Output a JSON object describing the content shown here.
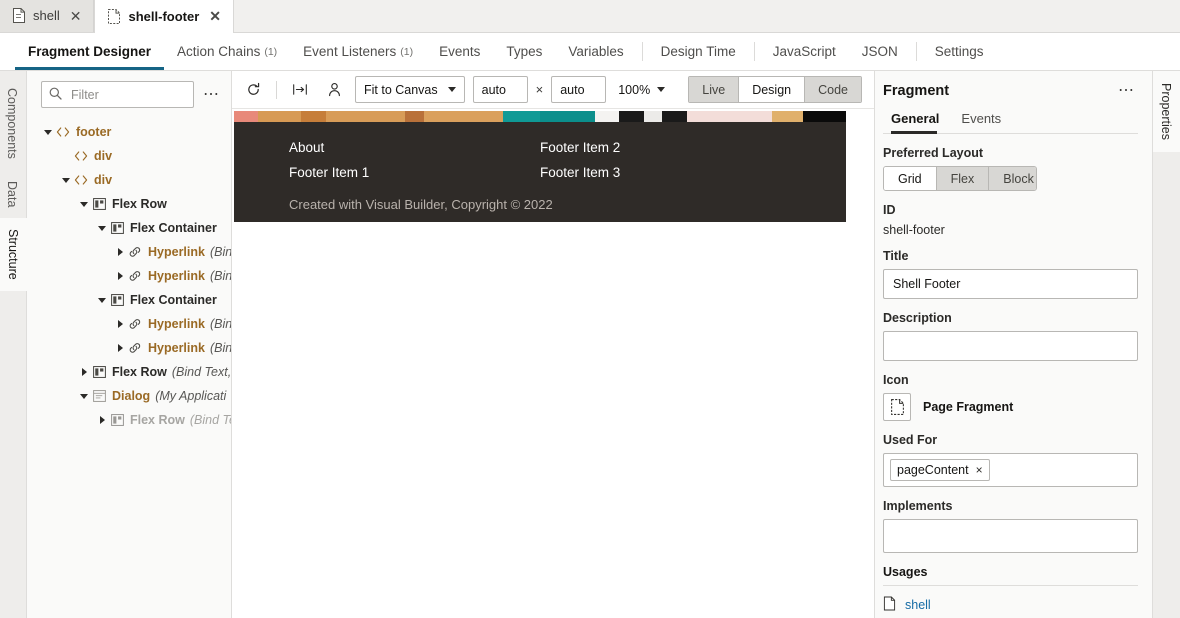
{
  "window_tabs": [
    {
      "label": "shell",
      "icon": "page-icon",
      "active": false
    },
    {
      "label": "shell-footer",
      "icon": "fragment-icon",
      "active": true
    }
  ],
  "nav_tabs": [
    {
      "label": "Fragment Designer",
      "count": "",
      "active": true,
      "sep_after": false
    },
    {
      "label": "Action Chains",
      "count": "(1)",
      "active": false,
      "sep_after": false
    },
    {
      "label": "Event Listeners",
      "count": "(1)",
      "active": false,
      "sep_after": false
    },
    {
      "label": "Events",
      "count": "",
      "active": false,
      "sep_after": false
    },
    {
      "label": "Types",
      "count": "",
      "active": false,
      "sep_after": false
    },
    {
      "label": "Variables",
      "count": "",
      "active": false,
      "sep_after": true
    },
    {
      "label": "Design Time",
      "count": "",
      "active": false,
      "sep_after": true
    },
    {
      "label": "JavaScript",
      "count": "",
      "active": false,
      "sep_after": false
    },
    {
      "label": "JSON",
      "count": "",
      "active": false,
      "sep_after": true
    },
    {
      "label": "Settings",
      "count": "",
      "active": false,
      "sep_after": false
    }
  ],
  "left_rail": [
    {
      "label": "Components",
      "active": false
    },
    {
      "label": "Data",
      "active": false
    },
    {
      "label": "Structure",
      "active": true
    }
  ],
  "right_rail": {
    "label": "Properties"
  },
  "filter": {
    "placeholder": "Filter",
    "value": "",
    "icon": "search-icon",
    "menu_icon": "overflow-menu-icon"
  },
  "tree": [
    {
      "indent": 0,
      "twisty": "down",
      "icon": "code-tag-icon",
      "label": "footer",
      "sub": "",
      "color": "tag"
    },
    {
      "indent": 1,
      "twisty": "none",
      "icon": "code-tag-icon",
      "label": "div",
      "sub": "",
      "color": "tag"
    },
    {
      "indent": 1,
      "twisty": "down",
      "icon": "code-tag-icon",
      "label": "div",
      "sub": "",
      "color": "tag"
    },
    {
      "indent": 2,
      "twisty": "down",
      "icon": "flex-row-icon",
      "label": "Flex Row",
      "sub": "",
      "color": "norm"
    },
    {
      "indent": 3,
      "twisty": "down",
      "icon": "flex-container-icon",
      "label": "Flex Container",
      "sub": "",
      "color": "norm"
    },
    {
      "indent": 4,
      "twisty": "right",
      "icon": "hyperlink-icon",
      "label": "Hyperlink",
      "sub": "(Bind",
      "color": "link"
    },
    {
      "indent": 4,
      "twisty": "right",
      "icon": "hyperlink-icon",
      "label": "Hyperlink",
      "sub": "(Bind",
      "color": "link"
    },
    {
      "indent": 3,
      "twisty": "down",
      "icon": "flex-container-icon",
      "label": "Flex Container",
      "sub": "",
      "color": "norm"
    },
    {
      "indent": 4,
      "twisty": "right",
      "icon": "hyperlink-icon",
      "label": "Hyperlink",
      "sub": "(Bind",
      "color": "link"
    },
    {
      "indent": 4,
      "twisty": "right",
      "icon": "hyperlink-icon",
      "label": "Hyperlink",
      "sub": "(Bind",
      "color": "link"
    },
    {
      "indent": 2,
      "twisty": "right",
      "icon": "flex-row-icon",
      "label": "Flex Row",
      "sub": "(Bind Text,",
      "color": "norm"
    },
    {
      "indent": 2,
      "twisty": "down",
      "icon": "dialog-icon",
      "label": "Dialog",
      "sub": "(My Applicati",
      "color": "tag"
    },
    {
      "indent": 3,
      "twisty": "right",
      "icon": "flex-row-icon",
      "label": "Flex Row",
      "sub": "(Bind Te",
      "color": "dim"
    }
  ],
  "canvas_toolbar": {
    "refresh_icon": "refresh-icon",
    "responsive_icon": "responsive-preview-icon",
    "user_icon": "user-icon",
    "canvas_size_label": "Fit to Canvas",
    "width_value": "auto",
    "height_value": "auto",
    "multiply_symbol": "×",
    "zoom_label": "100%",
    "modes": [
      {
        "label": "Live",
        "active": false
      },
      {
        "label": "Design",
        "active": true
      },
      {
        "label": "Code",
        "active": false
      }
    ]
  },
  "fragment_preview": {
    "background": "#2f2b28",
    "stripe": [
      {
        "color": "#e8897a",
        "width": 4
      },
      {
        "color": "#d79a54",
        "width": 7
      },
      {
        "color": "#c67e3a",
        "width": 4
      },
      {
        "color": "#d89c58",
        "width": 13
      },
      {
        "color": "#b9713a",
        "width": 3
      },
      {
        "color": "#daa05d",
        "width": 13
      },
      {
        "color": "#109a96",
        "width": 6
      },
      {
        "color": "#0c8f8c",
        "width": 9
      },
      {
        "color": "#f4f3f1",
        "width": 4
      },
      {
        "color": "#1a1a1a",
        "width": 4
      },
      {
        "color": "#ecebe9",
        "width": 3
      },
      {
        "color": "#1a1a1a",
        "width": 4
      },
      {
        "color": "#f3ddd9",
        "width": 14
      },
      {
        "color": "#e0b06c",
        "width": 5
      },
      {
        "color": "#0a0a0a",
        "width": 7
      }
    ],
    "links_left": [
      "About",
      "Footer Item 1"
    ],
    "links_right": [
      "Footer Item 2",
      "Footer Item 3"
    ],
    "copyright": "Created with Visual Builder, Copyright © 2022"
  },
  "properties": {
    "title": "Fragment",
    "menu_icon": "overflow-menu-icon",
    "tabs": [
      {
        "label": "General",
        "active": true
      },
      {
        "label": "Events",
        "active": false
      }
    ],
    "preferred_layout": {
      "label": "Preferred Layout",
      "options": [
        {
          "label": "Grid",
          "active": true
        },
        {
          "label": "Flex",
          "active": false
        },
        {
          "label": "Block",
          "active": false
        }
      ]
    },
    "id": {
      "label": "ID",
      "value": "shell-footer"
    },
    "title_field": {
      "label": "Title",
      "value": "Shell Footer",
      "placeholder": ""
    },
    "description": {
      "label": "Description",
      "value": "",
      "placeholder": ""
    },
    "icon": {
      "label": "Icon",
      "glyph": "page-fragment-icon",
      "value": "Page Fragment"
    },
    "used_for": {
      "label": "Used For",
      "chips": [
        "pageContent"
      ],
      "chip_remove": "×"
    },
    "implements": {
      "label": "Implements",
      "value": ""
    },
    "usages": {
      "label": "Usages",
      "items": [
        {
          "label": "shell",
          "icon": "page-icon"
        }
      ]
    }
  }
}
